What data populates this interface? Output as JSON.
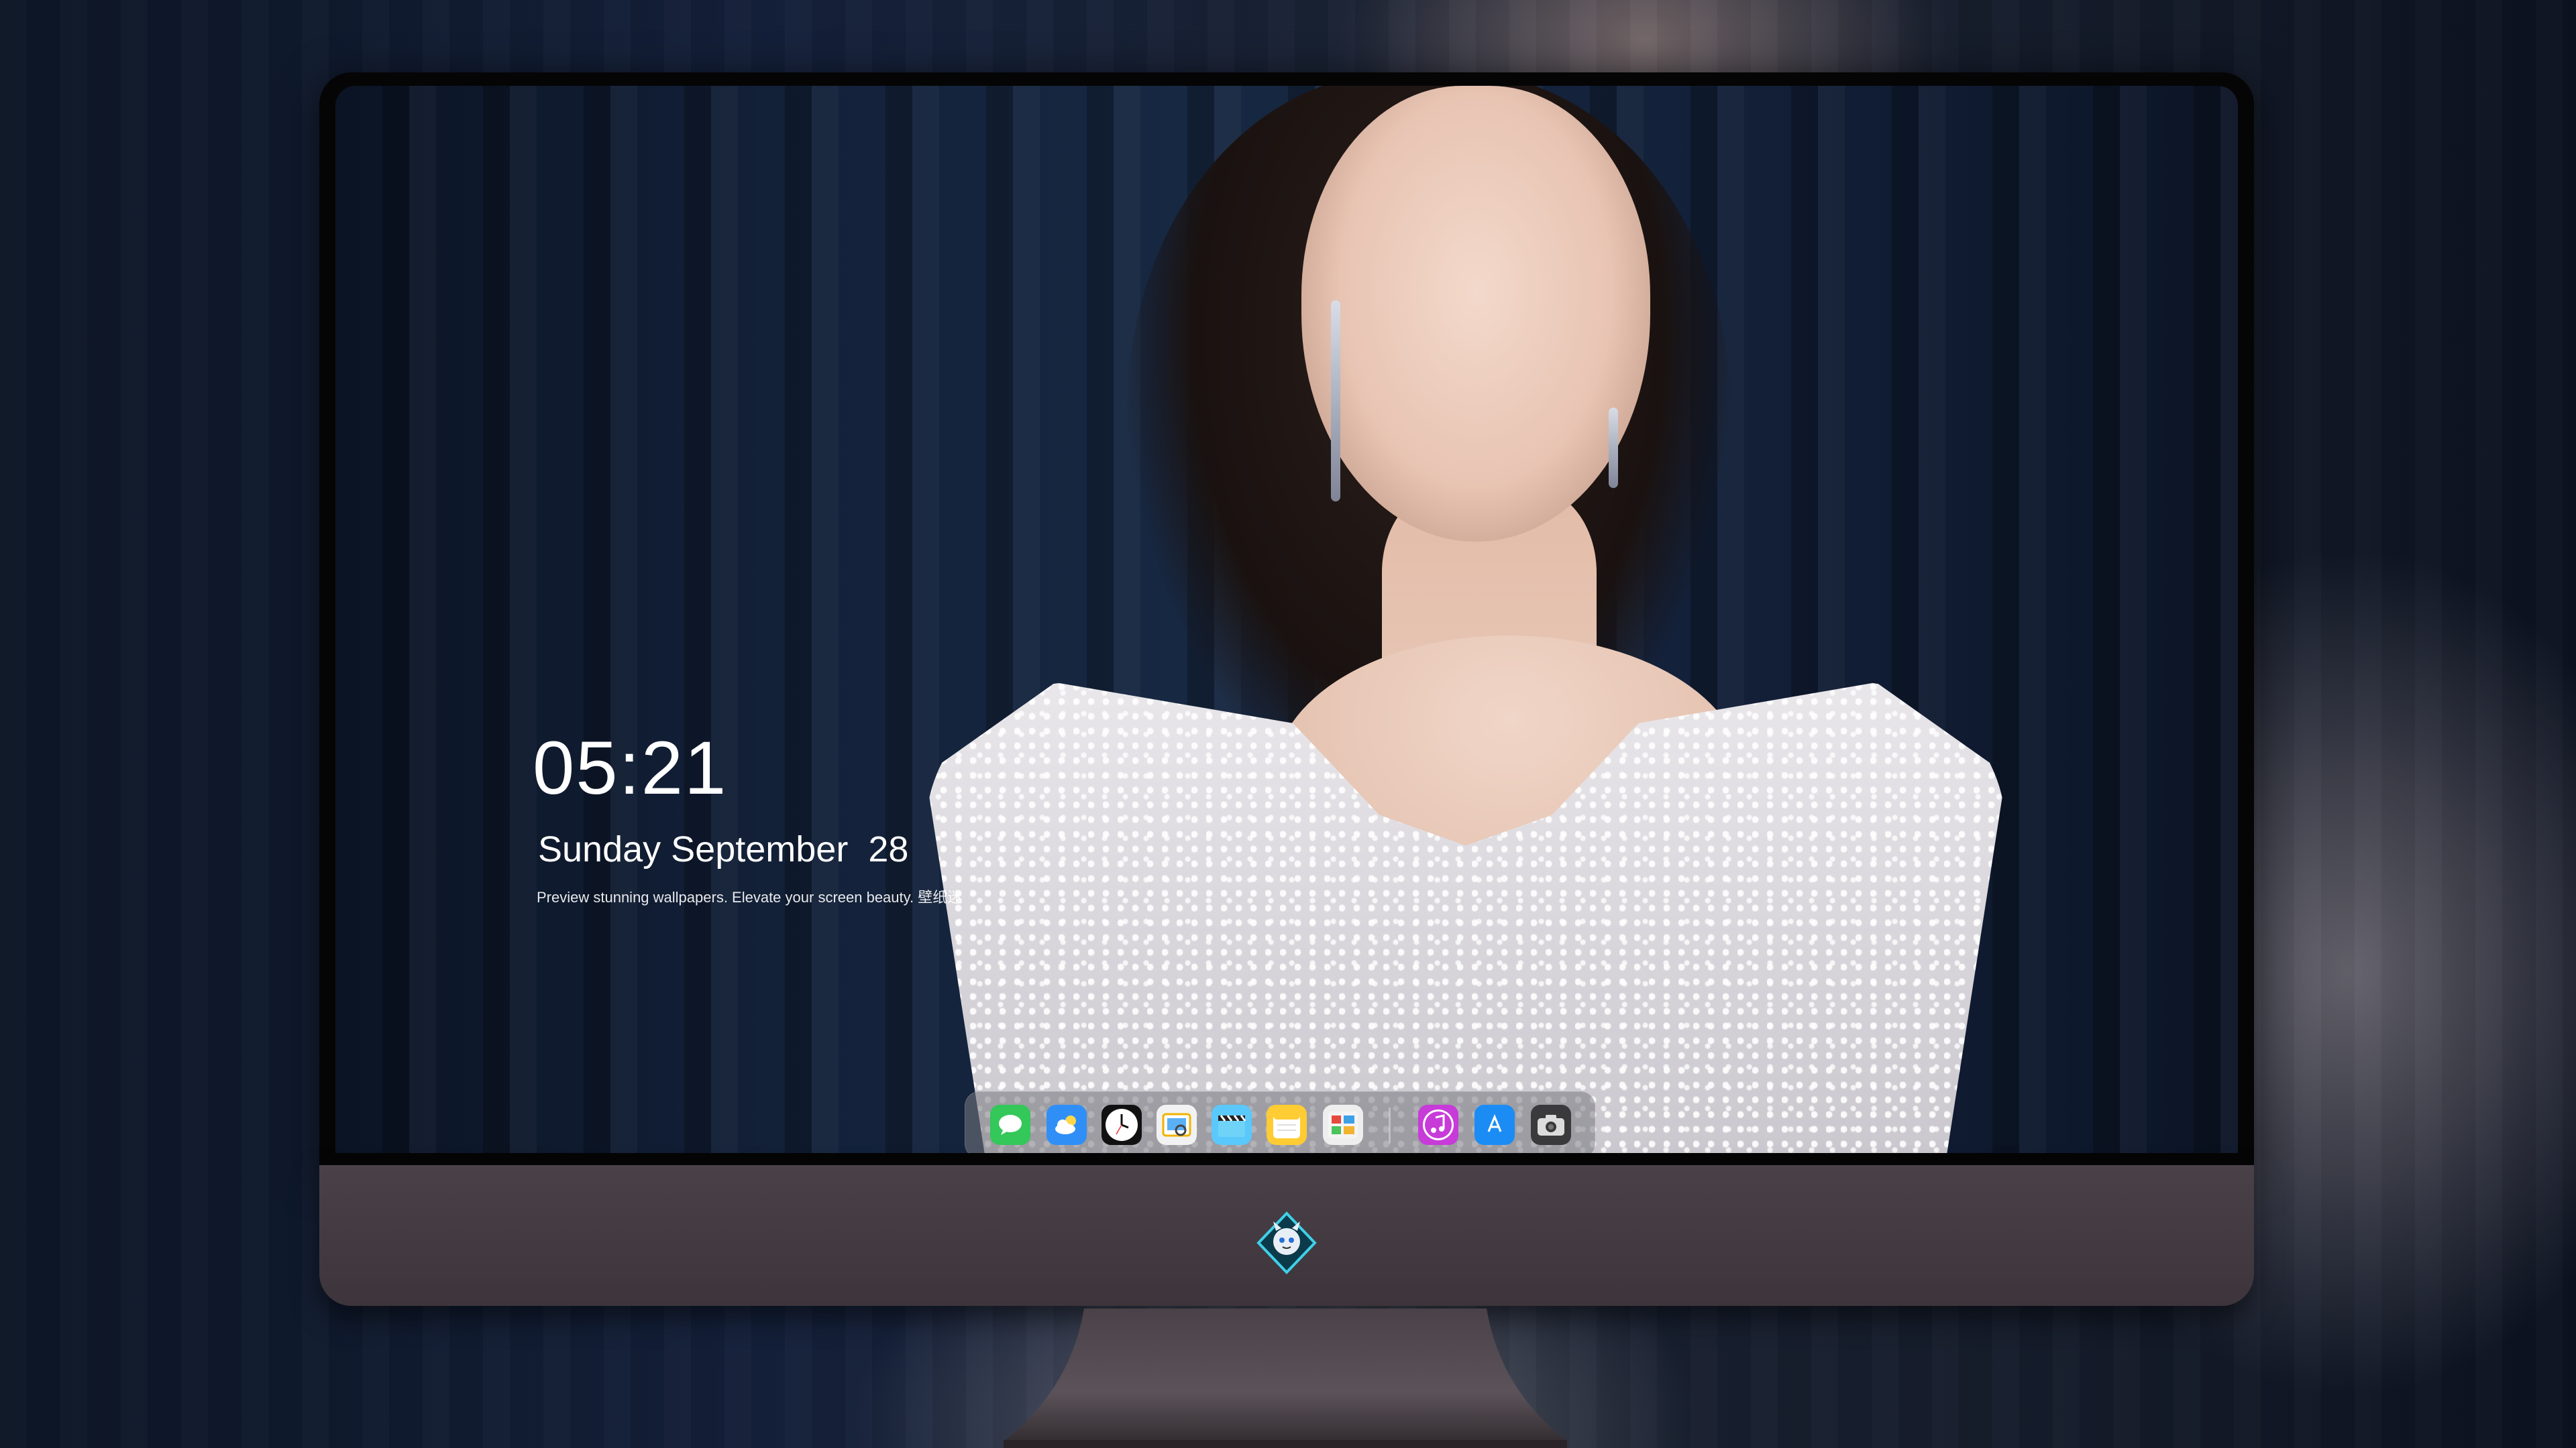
{
  "lockscreen": {
    "time": "05:21",
    "date_weekday_month": "Sunday September",
    "date_day": "28",
    "tagline": "Preview stunning wallpapers. Elevate your screen beauty. 壁纸迷"
  },
  "dock": {
    "apps": [
      {
        "name": "messages-icon",
        "color": "#34c759"
      },
      {
        "name": "weather-icon",
        "color": "#2f8ff7"
      },
      {
        "name": "clock-icon",
        "color": "#111111"
      },
      {
        "name": "preview-icon",
        "color": "#f2f2f2"
      },
      {
        "name": "clapperboard-icon",
        "color": "#5ac8fa"
      },
      {
        "name": "notes-icon",
        "color": "#ffcc33"
      },
      {
        "name": "photo-gallery-icon",
        "color": "#eeeeee"
      },
      {
        "name": "music-icon",
        "color": "#c73bd8"
      },
      {
        "name": "app-store-icon",
        "color": "#1c8cf5"
      },
      {
        "name": "camera-icon",
        "color": "#3a3a3c"
      }
    ]
  },
  "monitor": {
    "bezel_color": "#050505",
    "chin_color": "#463e44"
  }
}
